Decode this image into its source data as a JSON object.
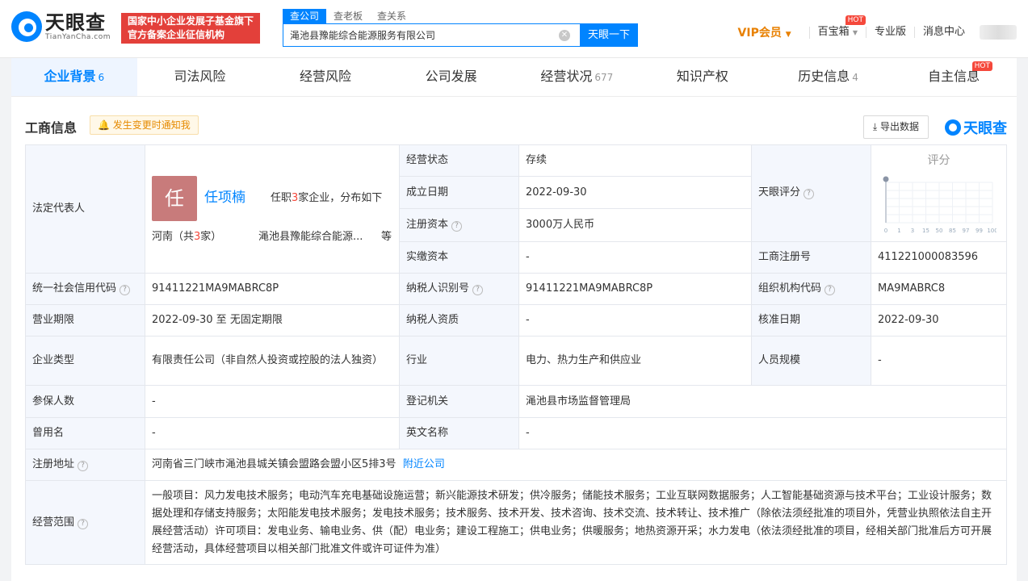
{
  "header": {
    "logo_cn": "天眼查",
    "logo_en": "TianYanCha.com",
    "badge_line1": "国家中小企业发展子基金旗下",
    "badge_line2": "官方备案企业征信机构",
    "search_tabs": [
      "查公司",
      "查老板",
      "查关系"
    ],
    "search_value": "渑池县豫能综合能源服务有限公司",
    "search_button": "天眼一下",
    "vip": "VIP会员",
    "nav": [
      "百宝箱",
      "专业版",
      "消息中心"
    ],
    "hot": "HOT"
  },
  "tabs": [
    {
      "label": "企业背景",
      "count": "6"
    },
    {
      "label": "司法风险",
      "count": ""
    },
    {
      "label": "经营风险",
      "count": ""
    },
    {
      "label": "公司发展",
      "count": ""
    },
    {
      "label": "经营状况",
      "count": "677"
    },
    {
      "label": "知识产权",
      "count": ""
    },
    {
      "label": "历史信息",
      "count": "4"
    },
    {
      "label": "自主信息",
      "count": ""
    }
  ],
  "section": {
    "title": "工商信息",
    "notify": "发生变更时通知我",
    "export": "导出数据",
    "brand": "天眼查"
  },
  "legal_rep": {
    "key": "法定代表人",
    "avatar_char": "任",
    "name": "任项楠",
    "desc_pre": "任职",
    "desc_num": "3",
    "desc_post": "家企业，分布如下",
    "prov_pre": "河南（共",
    "prov_num": "3",
    "prov_post": "家）",
    "company": "渑池县豫能综合能源...",
    "more": "等"
  },
  "rows": {
    "status_k": "经营状态",
    "status_v": "存续",
    "found_k": "成立日期",
    "found_v": "2022-09-30",
    "capital_k": "注册资本",
    "capital_v": "3000万人民币",
    "paid_k": "实缴资本",
    "paid_v": "-",
    "score_k": "天眼评分",
    "score_title": "评分",
    "score_ticks": [
      "0",
      "1",
      "3",
      "15",
      "50",
      "85",
      "97",
      "99",
      "100"
    ],
    "regno_k": "工商注册号",
    "regno_v": "411221000083596",
    "credit_k": "统一社会信用代码",
    "credit_v": "91411221MA9MABRC8P",
    "taxid_k": "纳税人识别号",
    "taxid_v": "91411221MA9MABRC8P",
    "orgcode_k": "组织机构代码",
    "orgcode_v": "MA9MABRC8",
    "term_k": "营业期限",
    "term_v": "2022-09-30 至 无固定期限",
    "taxq_k": "纳税人资质",
    "taxq_v": "-",
    "approve_k": "核准日期",
    "approve_v": "2022-09-30",
    "type_k": "企业类型",
    "type_v": "有限责任公司（非自然人投资或控股的法人独资）",
    "industry_k": "行业",
    "industry_v": "电力、热力生产和供应业",
    "staff_k": "人员规模",
    "staff_v": "-",
    "insured_k": "参保人数",
    "insured_v": "-",
    "authority_k": "登记机关",
    "authority_v": "渑池县市场监督管理局",
    "former_k": "曾用名",
    "former_v": "-",
    "english_k": "英文名称",
    "english_v": "-",
    "addr_k": "注册地址",
    "addr_v": "河南省三门峡市渑池县城关镇会盟路会盟小区5排3号",
    "addr_link": "附近公司",
    "scope_k": "经营范围",
    "scope_v": "一般项目：风力发电技术服务；电动汽车充电基础设施运营；新兴能源技术研发；供冷服务；储能技术服务；工业互联网数据服务；人工智能基础资源与技术平台；工业设计服务；数据处理和存储支持服务；太阳能发电技术服务；发电技术服务；技术服务、技术开发、技术咨询、技术交流、技术转让、技术推广（除依法须经批准的项目外，凭营业执照依法自主开展经营活动）许可项目：发电业务、输电业务、供（配）电业务；建设工程施工；供电业务；供暖服务；地热资源开采；水力发电（依法须经批准的项目，经相关部门批准后方可开展经营活动，具体经营项目以相关部门批准文件或许可证件为准）"
  }
}
